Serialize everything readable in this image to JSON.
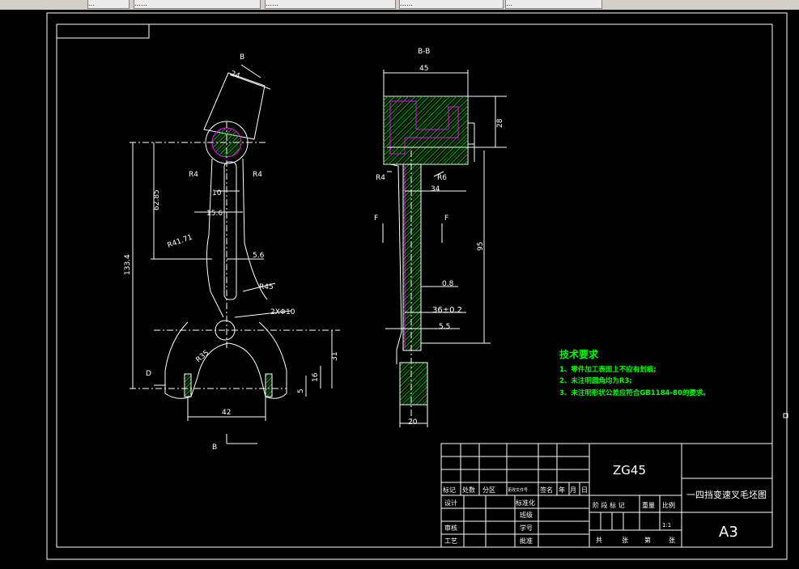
{
  "toolbar": {
    "tabs": [
      "…",
      "……",
      "……",
      "……",
      "…",
      "……"
    ]
  },
  "views": {
    "section_label": "B-B",
    "cut_label_top": "B",
    "cut_label_bottom": "B",
    "f_label_left": "F",
    "f_label_right": "F",
    "d_label": "D"
  },
  "dims_left": {
    "d24": "24",
    "r4_left": "R4",
    "r4_right": "R4",
    "d10": "10",
    "d15_6": "15.6",
    "d62_85": "62.85",
    "r41_71": "R41.71",
    "d5_6": "5.6",
    "d133_4": "133.4",
    "r45": "R45",
    "hole": "2XΦ10",
    "r35": "R35",
    "d31": "31",
    "d16": "16",
    "d5": "5",
    "d42": "42"
  },
  "dims_right": {
    "d45": "45",
    "d28": "28",
    "r4": "R4",
    "r6": "R6",
    "d34": "34",
    "d95": "95",
    "d0_8": "0.8",
    "d36": "36±0.2",
    "d5_5": "5.5",
    "d20": "20"
  },
  "notes": {
    "title": "技术要求",
    "lines": [
      "1、零件加工表面上不应有划痕;",
      "2、未注明圆角均为R3;",
      "3、未注明形状公差应符合GB1184-80的要求。"
    ]
  },
  "title_block": {
    "material": "ZG45",
    "drawing_name": "一四挡变速叉毛坯图",
    "sheet_size": "A3",
    "scale_value": "1:1",
    "header": [
      "标记",
      "处数",
      "分区",
      "更改文件号",
      "签名",
      "年",
      "月",
      "日"
    ],
    "labels": {
      "design": "设计",
      "standardize": "标准化",
      "class": "班级",
      "review": "审核",
      "student_no": "学号",
      "process": "工艺",
      "approve": "批准",
      "stage_mark": "阶 段 标 记",
      "weight": "重量",
      "scale": "比例",
      "total": "共",
      "sheets": "张",
      "page_no": "第",
      "sheets2": "张"
    }
  },
  "colors": {
    "line": "#ffffff",
    "hatch": "#00c000",
    "magenta": "#ff00ff",
    "notes": "#00ff00"
  }
}
